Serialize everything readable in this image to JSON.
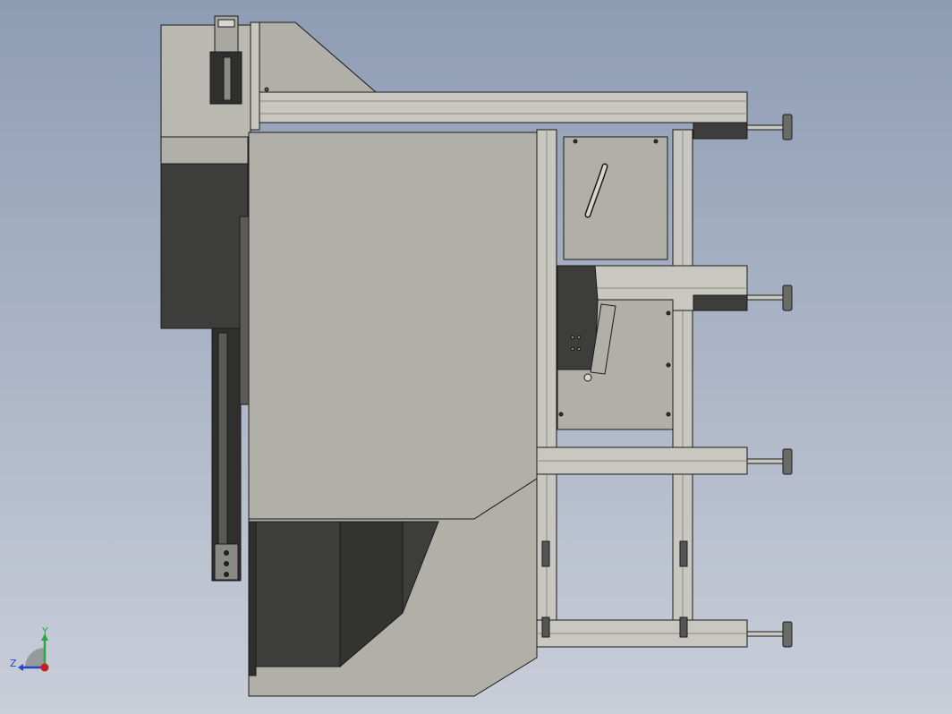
{
  "viewport": {
    "background_top": "#8e9cb4",
    "background_bottom": "#c9ced9"
  },
  "colors": {
    "panel_fill": "#b0b0a8",
    "panel_dark": "#3d3d3b",
    "panel_darker": "#2f2f2e",
    "profile_fill": "#c8c8c0",
    "profile_slot": "#8a8a84",
    "outline": "#1a1a1a",
    "axis_x": "#c81d1d",
    "axis_y": "#2aa843",
    "axis_z": "#2747c8"
  },
  "triad": {
    "y_label": "Y",
    "z_label": "Z",
    "x_marker_icon": "x-axis-dot-icon"
  }
}
